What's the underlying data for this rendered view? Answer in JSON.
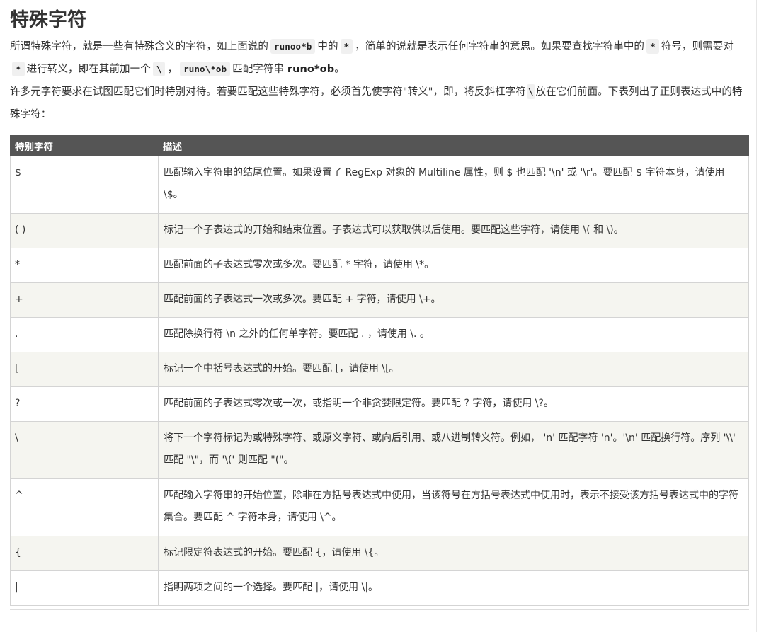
{
  "heading": "特殊字符",
  "intro1": {
    "t1": "所谓特殊字符，就是一些有特殊含义的字符，如上面说的",
    "c1": "runoo*b",
    "t2": "中的",
    "c2": "*",
    "t3": "，简单的说就是表示任何字符串的意思。如果要查找字符串中的",
    "c3": "*",
    "t4": "符号，则需要对",
    "c4": "*",
    "t5": "进行转义，即在其前加一个",
    "c5": "\\",
    "t6": "，",
    "c6": "runo\\*ob",
    "t7": "匹配字符串",
    "b1": "runo*ob",
    "t8": "。"
  },
  "intro2": {
    "t1": "许多元字符要求在试图匹配它们时特别对待。若要匹配这些特殊字符，必须首先使字符\"转义\"，即，将反斜杠字符",
    "c1": "\\",
    "t2": "放在它们前面。下表列出了正则表达式中的特殊字符："
  },
  "table": {
    "headers": [
      "特别字符",
      "描述"
    ],
    "rows": [
      {
        "char": "$",
        "desc": "匹配输入字符串的结尾位置。如果设置了 RegExp 对象的 Multiline 属性，则 $ 也匹配 '\\n' 或 '\\r'。要匹配 $ 字符本身，请使用 \\$。"
      },
      {
        "char": "( )",
        "desc": "标记一个子表达式的开始和结束位置。子表达式可以获取供以后使用。要匹配这些字符，请使用 \\( 和 \\)。"
      },
      {
        "char": "*",
        "desc": "匹配前面的子表达式零次或多次。要匹配 * 字符，请使用 \\*。"
      },
      {
        "char": "+",
        "desc": "匹配前面的子表达式一次或多次。要匹配 + 字符，请使用 \\+。"
      },
      {
        "char": ".",
        "desc": "匹配除换行符 \\n 之外的任何单字符。要匹配 . ，请使用 \\. 。"
      },
      {
        "char": "[",
        "desc": "标记一个中括号表达式的开始。要匹配 [，请使用 \\[。"
      },
      {
        "char": "?",
        "desc": "匹配前面的子表达式零次或一次，或指明一个非贪婪限定符。要匹配 ? 字符，请使用 \\?。"
      },
      {
        "char": "\\",
        "desc": "将下一个字符标记为或特殊字符、或原义字符、或向后引用、或八进制转义符。例如， 'n' 匹配字符 'n'。'\\n' 匹配换行符。序列 '\\\\' 匹配 \"\\\"，而 '\\(' 则匹配 \"(\"。"
      },
      {
        "char": "^",
        "desc": "匹配输入字符串的开始位置，除非在方括号表达式中使用，当该符号在方括号表达式中使用时，表示不接受该方括号表达式中的字符集合。要匹配 ^ 字符本身，请使用 \\^。"
      },
      {
        "char": "{",
        "desc": "标记限定符表达式的开始。要匹配 {，请使用 \\{。"
      },
      {
        "char": "|",
        "desc": "指明两项之间的一个选择。要匹配 |，请使用 \\|。"
      }
    ]
  }
}
